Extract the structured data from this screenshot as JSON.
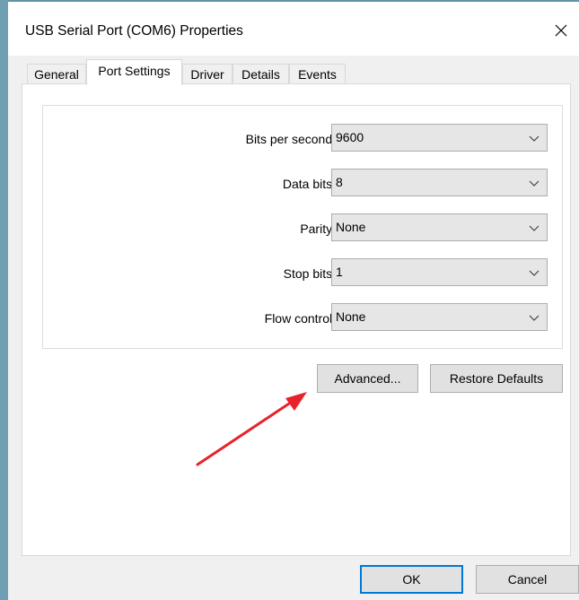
{
  "window": {
    "title": "USB Serial Port (COM6) Properties",
    "close_icon": "close-icon"
  },
  "tabs": [
    {
      "label": "General"
    },
    {
      "label": "Port Settings",
      "active": true
    },
    {
      "label": "Driver"
    },
    {
      "label": "Details"
    },
    {
      "label": "Events"
    }
  ],
  "settings": [
    {
      "label": "Bits per second:",
      "value": "9600"
    },
    {
      "label": "Data bits:",
      "value": "8"
    },
    {
      "label": "Parity:",
      "value": "None"
    },
    {
      "label": "Stop bits:",
      "value": "1"
    },
    {
      "label": "Flow control:",
      "value": "None"
    }
  ],
  "buttons": {
    "advanced": "Advanced...",
    "restore_defaults": "Restore Defaults",
    "ok": "OK",
    "cancel": "Cancel"
  },
  "annotation": {
    "arrow_color": "#e8222b"
  },
  "colors": {
    "frame": "#6f9fb3",
    "focus": "#0078d7"
  }
}
